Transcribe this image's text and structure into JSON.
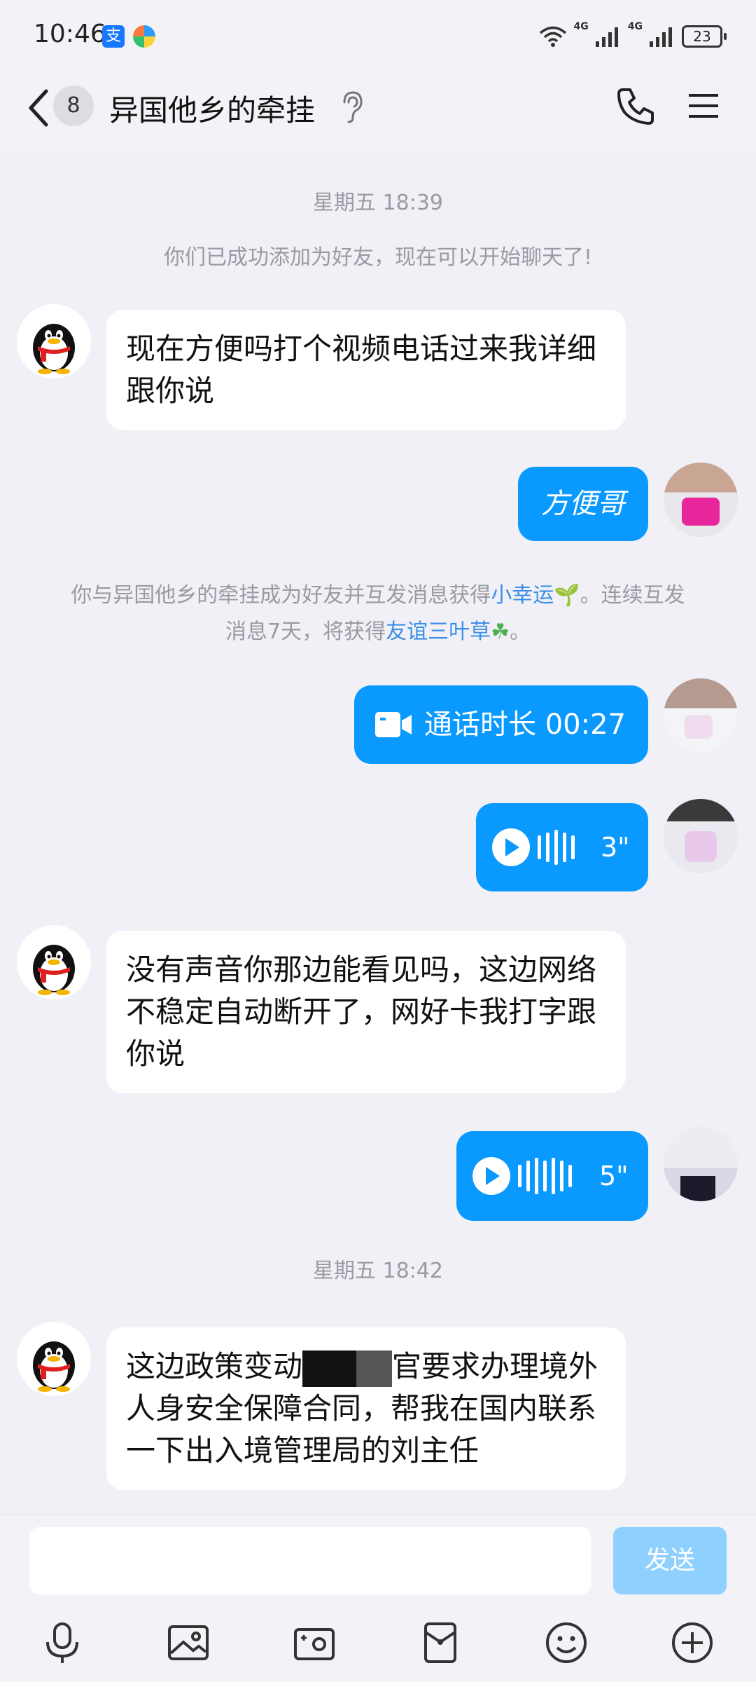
{
  "status_bar": {
    "time": "10:46",
    "alipay_glyph": "支",
    "network_1": "4G",
    "network_2": "4G",
    "battery": "23"
  },
  "header": {
    "unread_count": "8",
    "title": "异国他乡的牵挂"
  },
  "messages": {
    "time_1": "星期五 18:39",
    "sys_added": "你们已成功添加为好友，现在可以开始聊天了!",
    "m1": "现在方便吗打个视频电话过来我详细跟你说",
    "m2": "方便哥",
    "sys_luck_1": "你与异国他乡的牵挂成为好友并互发消息获得",
    "sys_luck_link_1": "小幸运",
    "sys_luck_2": "。连续互发",
    "sys_luck_3": "消息7天，将获得",
    "sys_luck_link_2": "友谊三叶草",
    "sys_luck_4": "。",
    "call": "通话时长 00:27",
    "voice_1": "3\"",
    "m3": "没有声音你那边能看见吗，这边网络不稳定自动断开了，网好卡我打字跟你说",
    "voice_2": "5\"",
    "time_2": "星期五 18:42",
    "m4_a": "这边政策变动",
    "m4_b": "官要求办理境外人身安全保障合同，帮我在国内联系一下出入境管理局的刘主任"
  },
  "input": {
    "send_label": "发送"
  },
  "icons": [
    "mic-icon",
    "image-icon",
    "camera-icon",
    "hongbao-icon",
    "emoji-icon",
    "plus-icon"
  ],
  "colors": {
    "accent": "#0a99ff",
    "link": "#3b8fe6",
    "send_disabled": "#8fd0ff"
  }
}
